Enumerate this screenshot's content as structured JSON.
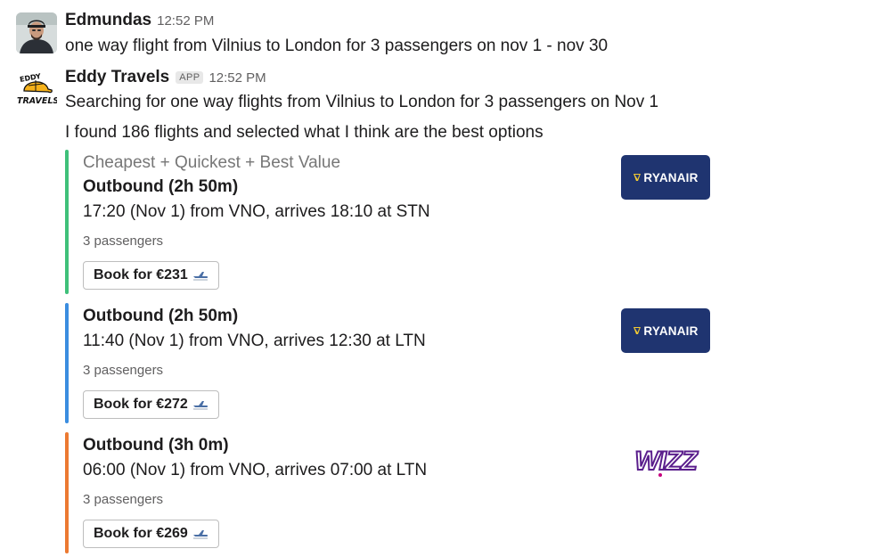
{
  "messages": [
    {
      "sender": "Edmundas",
      "time": "12:52 PM",
      "text": "one way flight from Vilnius to London for 3 passengers on nov 1 - nov 30"
    },
    {
      "sender": "Eddy Travels",
      "badge": "APP",
      "time": "12:52 PM",
      "lines": [
        "Searching for one way flights from Vilnius to London for 3 passengers on Nov 1",
        "I found 186 flights and selected what I think are the best options"
      ]
    }
  ],
  "options": [
    {
      "pretext": "Cheapest + Quickest + Best Value",
      "title": "Outbound (2h 50m)",
      "detail": "17:20 (Nov 1) from VNO, arrives 18:10 at STN",
      "passengers": "3 passengers",
      "book_label": "Book for €231",
      "airline": "RYANAIR",
      "color": "#3fc07a"
    },
    {
      "title": "Outbound (2h 50m)",
      "detail": "11:40 (Nov 1) from VNO, arrives 12:30 at LTN",
      "passengers": "3 passengers",
      "book_label": "Book for €272",
      "airline": "RYANAIR",
      "color": "#3b8de0"
    },
    {
      "title": "Outbound (3h 0m)",
      "detail": "06:00 (Nov 1) from VNO, arrives 07:00 at LTN",
      "passengers": "3 passengers",
      "book_label": "Book for €269",
      "airline": "WIZZ",
      "color": "#ec7a32"
    }
  ],
  "colors": {
    "ryanair_blue": "#1f3470",
    "wizz_purple": "#5a1e8c",
    "wizz_magenta": "#c6007e"
  },
  "icons": [
    "user-avatar",
    "eddy-travels-logo",
    "airplane-icon",
    "ryanair-harp-icon",
    "wizz-logo"
  ]
}
